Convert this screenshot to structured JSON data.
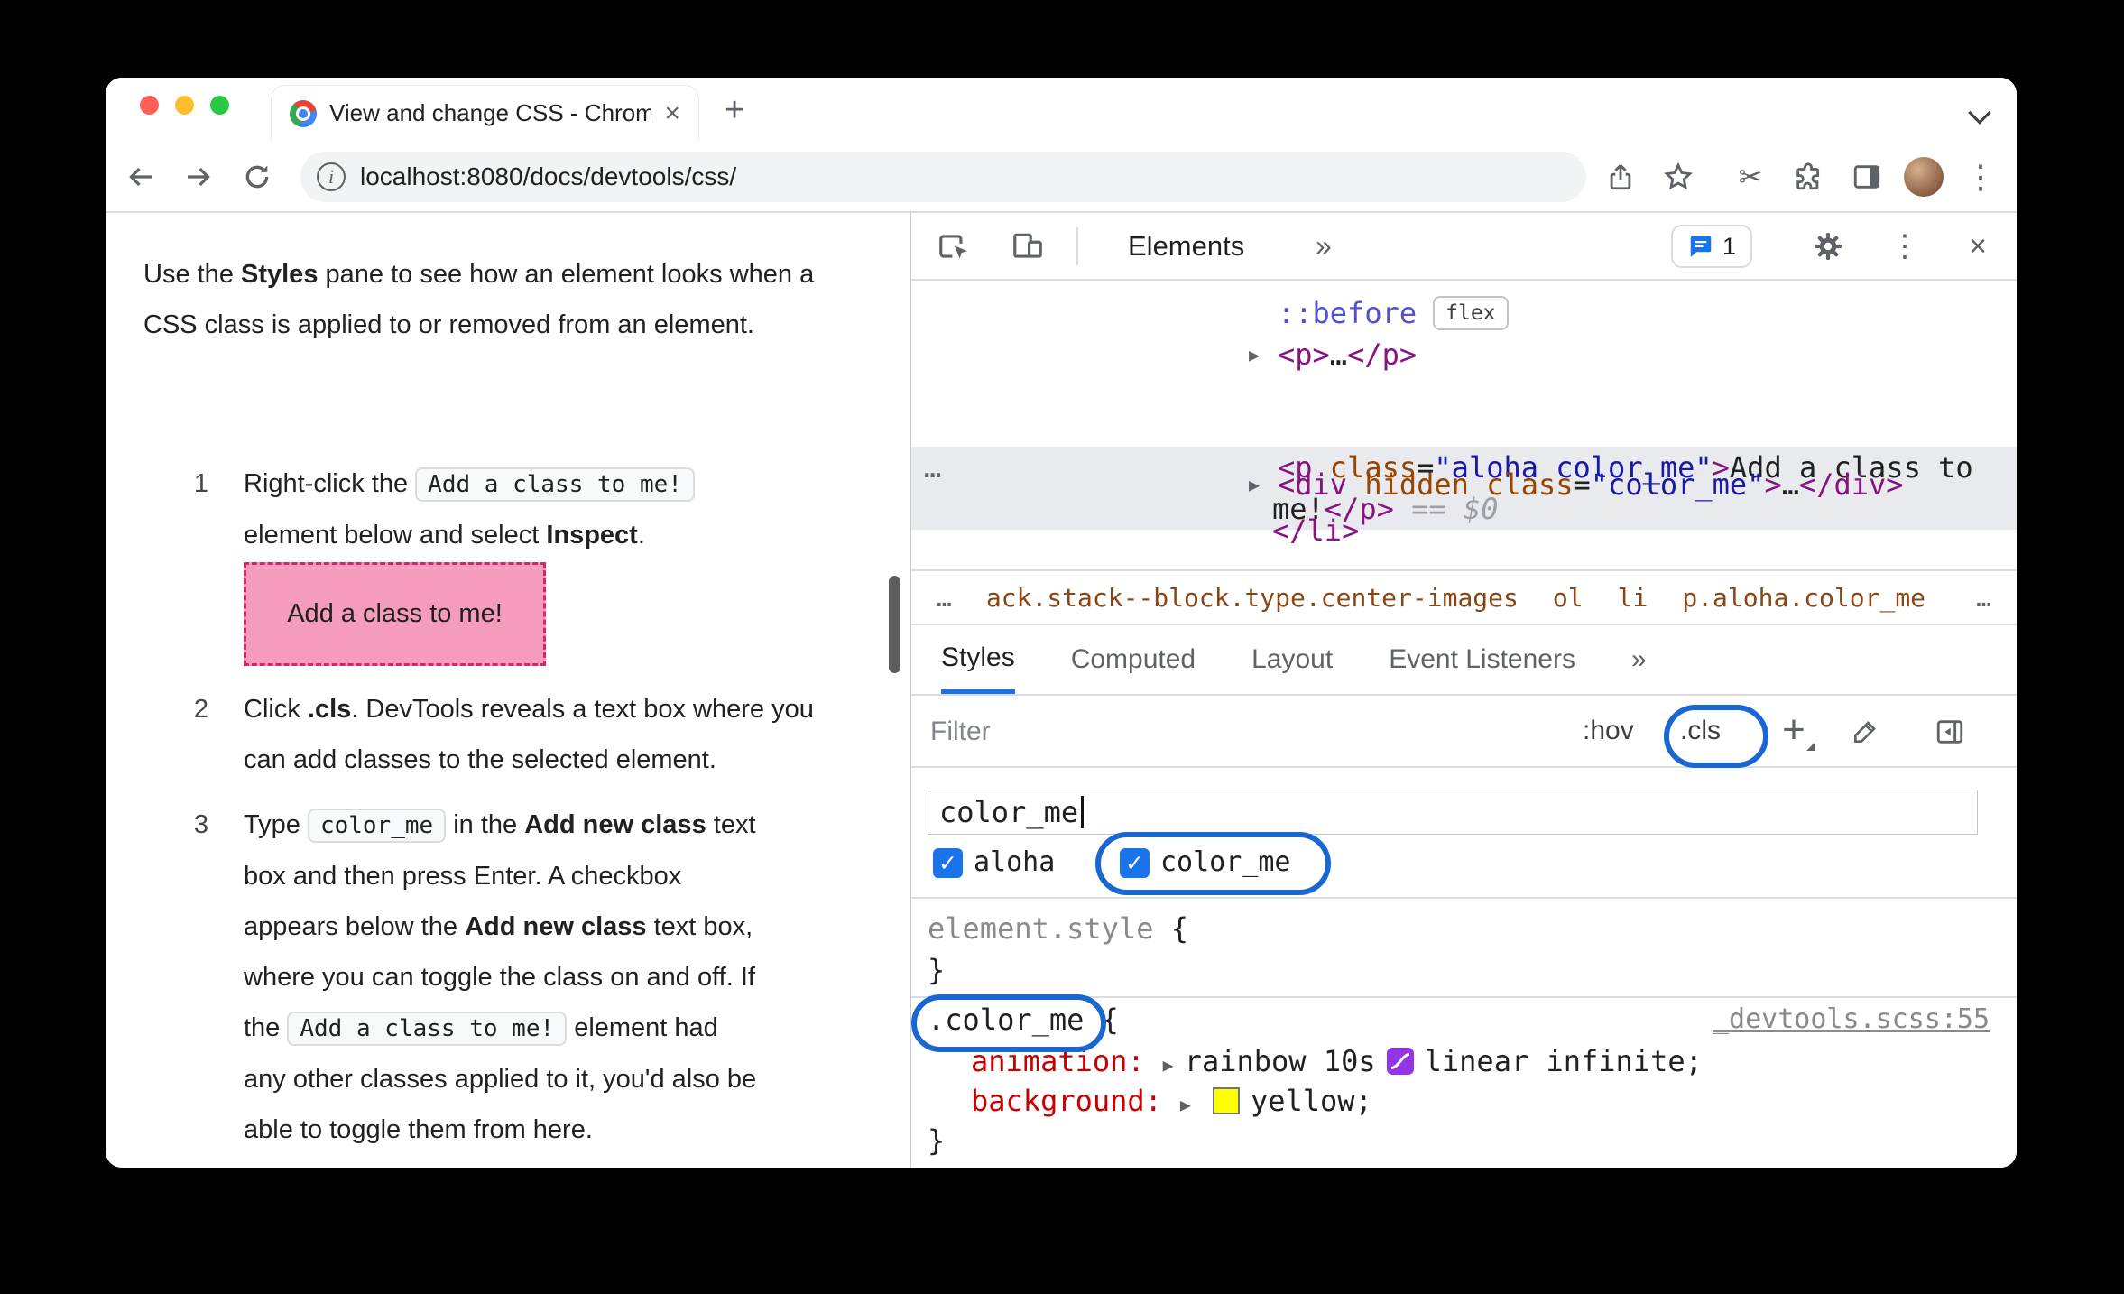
{
  "colors": {
    "annotation_blue": "#1967d2",
    "accent_blue": "#1a73e8",
    "tag_purple": "#881280",
    "attr_name_orange": "#994500",
    "attr_value_blue": "#1a1aa6",
    "pseudo_blue": "#5151d3",
    "property_red": "#c80000",
    "breadcrumb_brown": "#8b4513",
    "selected_row_gray": "#e8eaed",
    "demo_pink_bg": "#f59bbb",
    "demo_pink_border": "#d6246e",
    "swatch_yellow": "#ffff00",
    "easing_purple": "#9334e6"
  },
  "icons": {
    "info": "i",
    "scissors": "✂",
    "more_vert": "⋮",
    "close": "×",
    "new_tab": "+",
    "more_tabs": "»",
    "triangle": "▶",
    "check": "✓",
    "new_rule_plus": "+",
    "ellipsis": "…"
  },
  "browser": {
    "tab_title": "View and change CSS - Chrom",
    "url": "localhost:8080/docs/devtools/css/"
  },
  "article": {
    "intro": {
      "t1": "Use the ",
      "b1": "Styles",
      "t2": " pane to see how an element looks when a CSS class is applied to or removed from an element."
    },
    "steps": [
      {
        "num": "1",
        "t1": "Right-click the ",
        "code1": "Add a class to me!",
        "t2": " element below and select ",
        "b1": "Inspect",
        "t3": "."
      },
      {
        "num": "2",
        "t1": "Click ",
        "b1": ".cls",
        "t2": ". DevTools reveals a text box where you can add classes to the selected element."
      },
      {
        "num": "3",
        "t1": "Type ",
        "code1": "color_me",
        "t2": " in the ",
        "b1": "Add new class",
        "t3": " text box and then press Enter. A checkbox appears below the ",
        "b2": "Add new class",
        "t4": " text box, where you can toggle the class on and off. If the ",
        "code2": "Add a class to me!",
        "t5": " element had any other classes applied to it, you'd also be able to toggle them from here."
      }
    ],
    "demo_button": "Add a class to me!"
  },
  "devtools": {
    "toolbar": {
      "elements_tab": "Elements",
      "issues_count": "1"
    },
    "dom": {
      "pseudo": "::before",
      "flex_badge": "flex",
      "p_collapsed": {
        "open": "<p>",
        "dots": "…",
        "close": "</p>"
      },
      "selected": {
        "menu_dots": "…",
        "tag_open": "<p",
        "attr_name": " class",
        "eq": "=",
        "attr_value": "\"aloha color_me\"",
        "bracket": ">",
        "text1": "Add a class to",
        "text2": "me!",
        "tag_close": "</p>",
        "meta": " == $0"
      },
      "div_row": {
        "tag_open": "<div",
        "attr_hidden": " hidden",
        "attr_class": " class",
        "eq": "=",
        "attr_value": "\"color_me\"",
        "bracket": ">",
        "dots": "…",
        "tag_close": "</div>"
      },
      "li_close": "</li>"
    },
    "crumbs": {
      "overflow_left": "…",
      "items": [
        "ack.stack--block.type.center-images",
        "ol",
        "li",
        "p.aloha.color_me"
      ],
      "overflow_right": "…"
    },
    "panes": [
      "Styles",
      "Computed",
      "Layout",
      "Event Listeners"
    ],
    "filter": {
      "placeholder": "Filter",
      "hov": ":hov",
      "cls": ".cls"
    },
    "class_editor": {
      "value": "color_me",
      "checkboxes": [
        {
          "label": "aloha",
          "checked": true
        },
        {
          "label": "color_me",
          "checked": true
        }
      ]
    },
    "styles": {
      "element_style": {
        "selector": "element.style",
        "open": " {",
        "close": "}"
      },
      "rule": {
        "selector": ".color_me",
        "open": " {",
        "source": "_devtools.scss:55",
        "animation": {
          "name": "animation:",
          "v1": "rainbow 10s",
          "v2": "linear infinite;"
        },
        "background": {
          "name": "background:",
          "v1": "yellow;"
        },
        "close": "}"
      }
    }
  }
}
